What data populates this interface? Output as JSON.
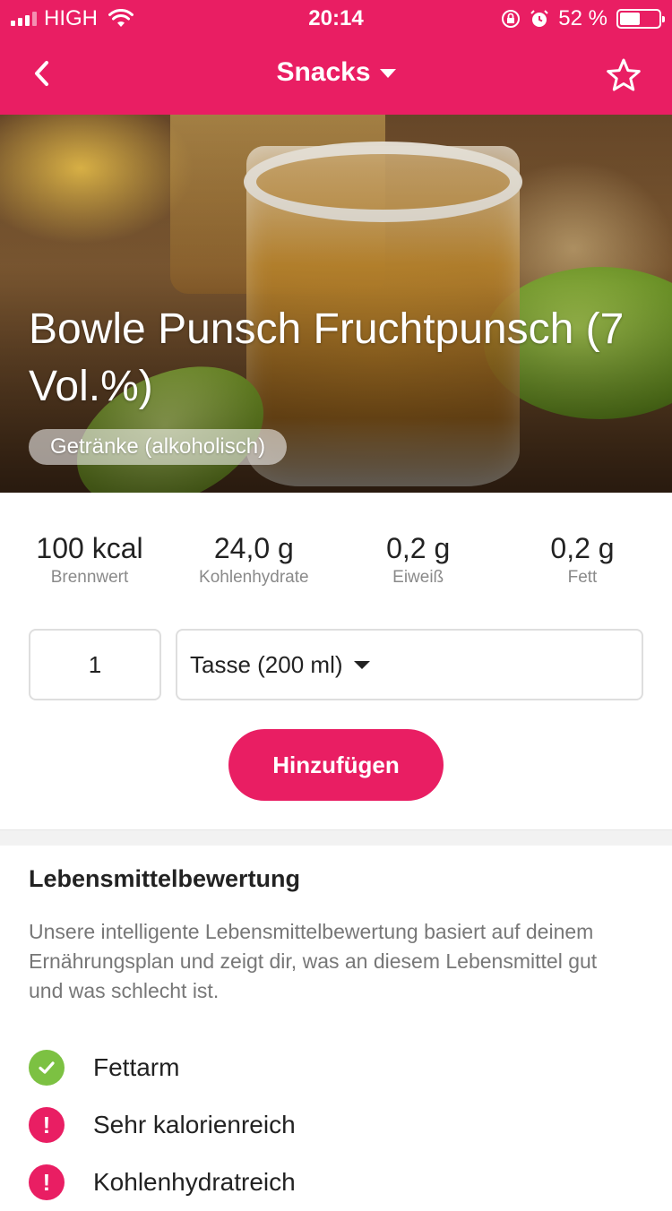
{
  "status_bar": {
    "carrier": "HIGH",
    "time": "20:14",
    "battery_percent": "52 %",
    "battery_level": 0.52
  },
  "nav": {
    "title": "Snacks",
    "back_icon": "chevron-left-icon",
    "favorite_icon": "star-outline-icon"
  },
  "food": {
    "title": "Bowle Punsch Fruchtpunsch (7 Vol.%)",
    "category": "Getränke (alkoholisch)"
  },
  "nutrition": [
    {
      "value": "100 kcal",
      "label": "Brennwert"
    },
    {
      "value": "24,0 g",
      "label": "Kohlenhydrate"
    },
    {
      "value": "0,2 g",
      "label": "Eiweiß"
    },
    {
      "value": "0,2 g",
      "label": "Fett"
    }
  ],
  "serving": {
    "quantity": "1",
    "unit": "Tasse (200 ml)"
  },
  "actions": {
    "add_label": "Hinzufügen"
  },
  "rating": {
    "title": "Lebensmittelbewertung",
    "description": "Unsere intelligente Lebensmittelbewertung basiert auf deinem Ernährungsplan und zeigt dir, was an diesem Lebensmittel gut und was schlecht ist.",
    "items": [
      {
        "label": "Fettarm",
        "status": "good"
      },
      {
        "label": "Sehr kalorienreich",
        "status": "bad"
      },
      {
        "label": "Kohlenhydratreich",
        "status": "bad"
      }
    ]
  },
  "colors": {
    "accent": "#e91e63",
    "good": "#7cc142"
  }
}
